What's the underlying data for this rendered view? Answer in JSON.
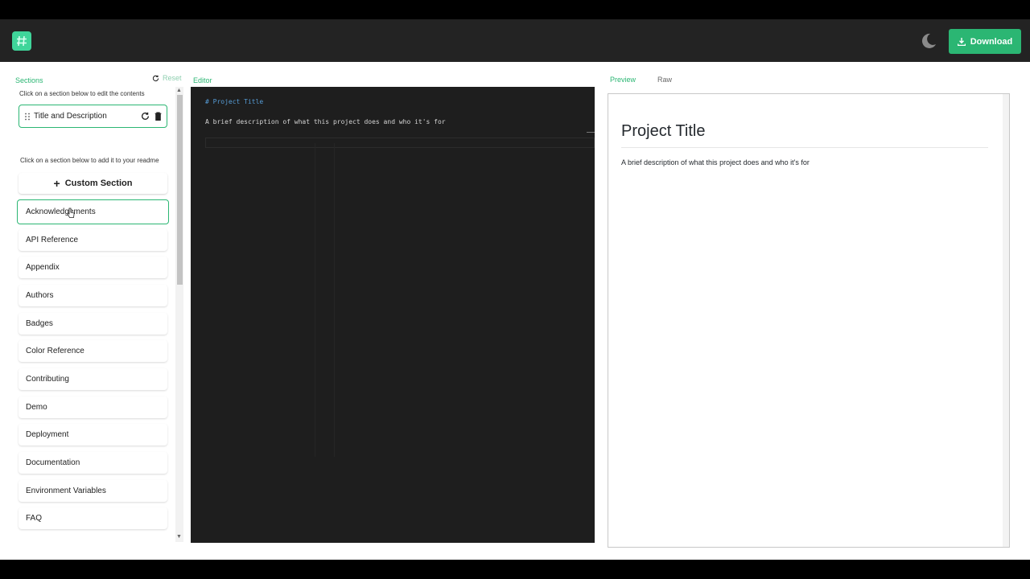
{
  "header": {
    "logo_icon": "hash-logo-icon",
    "theme_icon": "moon-icon",
    "download_label": "Download"
  },
  "sections_panel": {
    "title": "Sections",
    "reset_label": "Reset",
    "edit_hint": "Click on a section below to edit the contents",
    "selected": [
      "Title and Description"
    ],
    "add_hint": "Click on a section below to add it to your readme",
    "custom_section_label": "Custom Section",
    "available": [
      "Acknowledgements",
      "API Reference",
      "Appendix",
      "Authors",
      "Badges",
      "Color Reference",
      "Contributing",
      "Demo",
      "Deployment",
      "Documentation",
      "Environment Variables",
      "FAQ"
    ],
    "hovered_index": 0
  },
  "editor": {
    "label": "Editor",
    "lines": [
      "# Project Title",
      "A brief description of what this project does and who it's for"
    ]
  },
  "preview": {
    "tabs": [
      "Preview",
      "Raw"
    ],
    "active_tab": "Preview",
    "title": "Project Title",
    "description": "A brief description of what this project does and who it's for"
  },
  "colors": {
    "accent": "#2bb673",
    "navbar": "#232323",
    "editor_bg": "#1e1e1e"
  }
}
